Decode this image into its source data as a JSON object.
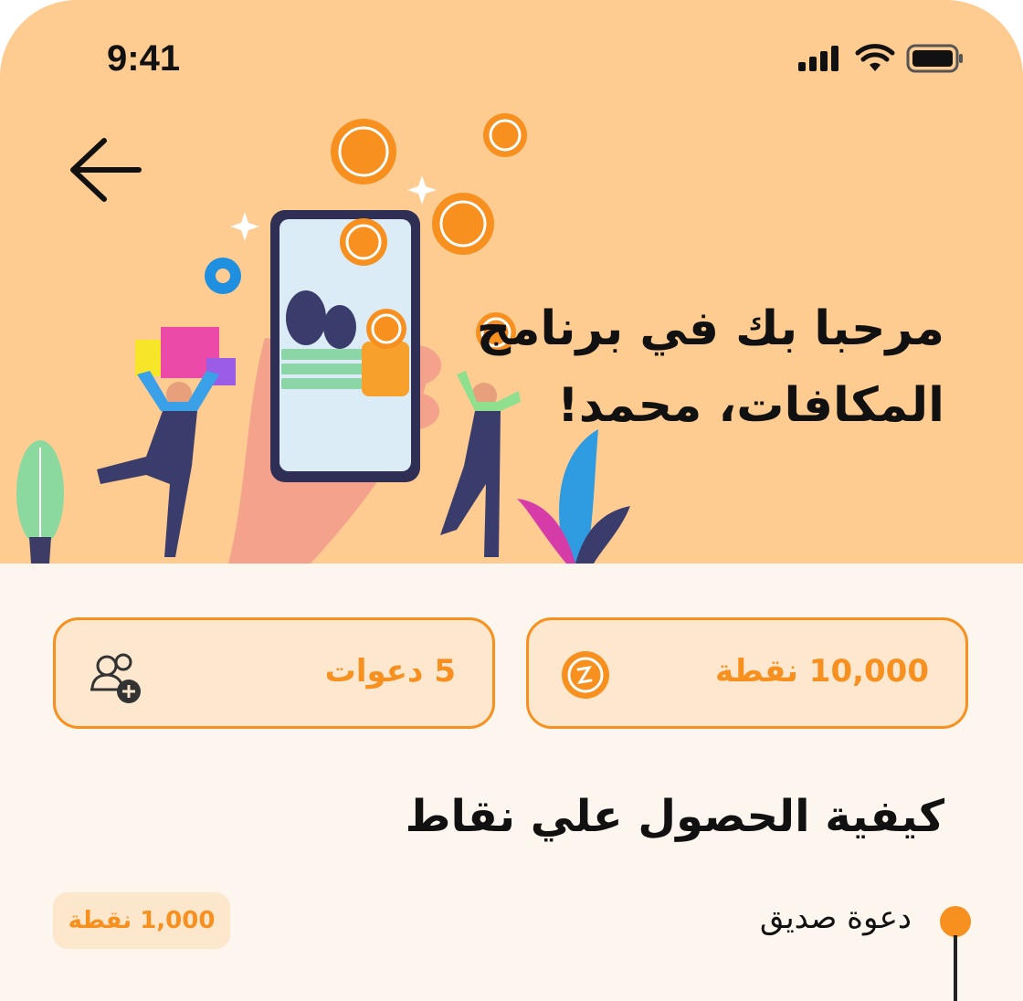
{
  "status_bar": {
    "time": "9:41"
  },
  "hero": {
    "welcome_text": "مرحبا بك في برنامج المكافات، محمد!"
  },
  "stats": {
    "points_label": "10,000 نقطة",
    "invites_label": "5 دعوات"
  },
  "how_to_earn": {
    "title": "كيفية الحصول علي نقاط",
    "steps": [
      {
        "label": "دعوة صديق",
        "points": "1,000 نقطة"
      }
    ]
  },
  "colors": {
    "accent": "#f7901e",
    "hero_bg": "#fecb91",
    "page_bg": "#fdf6ee",
    "card_bg": "#fde8cf"
  },
  "icons": [
    "back-arrow-icon",
    "signal-icon",
    "wifi-icon",
    "battery-icon",
    "coin-icon",
    "invite-user-icon"
  ]
}
